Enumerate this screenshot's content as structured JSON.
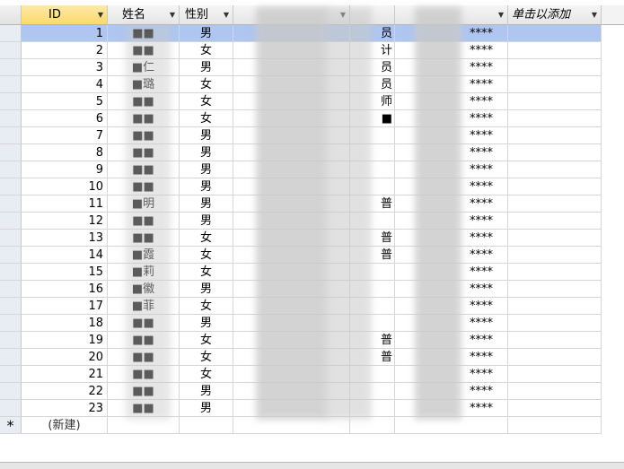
{
  "columns": {
    "id": "ID",
    "name": "姓名",
    "gender": "性别",
    "add_column": "单击以添加"
  },
  "rows": [
    {
      "id": "1",
      "name": "■■",
      "gender": "男",
      "title": "员",
      "phone_suffix": "****"
    },
    {
      "id": "2",
      "name": "■■",
      "gender": "女",
      "title": "计",
      "phone_suffix": "****"
    },
    {
      "id": "3",
      "name": "■仁",
      "gender": "男",
      "title": "员",
      "phone_suffix": "****"
    },
    {
      "id": "4",
      "name": "■璐",
      "gender": "女",
      "title": "员",
      "phone_suffix": "****"
    },
    {
      "id": "5",
      "name": "■■",
      "gender": "女",
      "title": "师",
      "phone_suffix": "****"
    },
    {
      "id": "6",
      "name": "■■",
      "gender": "女",
      "title": "■",
      "phone_suffix": "****"
    },
    {
      "id": "7",
      "name": "■■",
      "gender": "男",
      "title": "",
      "phone_suffix": "****"
    },
    {
      "id": "8",
      "name": "■■",
      "gender": "男",
      "title": "",
      "phone_suffix": "****"
    },
    {
      "id": "9",
      "name": "■■",
      "gender": "男",
      "title": "",
      "phone_suffix": "****"
    },
    {
      "id": "10",
      "name": "■■",
      "gender": "男",
      "title": "",
      "phone_suffix": "****"
    },
    {
      "id": "11",
      "name": "■明",
      "gender": "男",
      "title": "普",
      "phone_suffix": "****"
    },
    {
      "id": "12",
      "name": "■■",
      "gender": "男",
      "title": "",
      "phone_suffix": "****"
    },
    {
      "id": "13",
      "name": "■■",
      "gender": "女",
      "title": "普",
      "phone_suffix": "****"
    },
    {
      "id": "14",
      "name": "■霞",
      "gender": "女",
      "title": "普",
      "phone_suffix": "****"
    },
    {
      "id": "15",
      "name": "■莉",
      "gender": "女",
      "title": "",
      "phone_suffix": "****"
    },
    {
      "id": "16",
      "name": "■徽",
      "gender": "男",
      "title": "",
      "phone_suffix": "****"
    },
    {
      "id": "17",
      "name": "■菲",
      "gender": "女",
      "title": "",
      "phone_suffix": "****"
    },
    {
      "id": "18",
      "name": "■■",
      "gender": "男",
      "title": "",
      "phone_suffix": "****"
    },
    {
      "id": "19",
      "name": "■■",
      "gender": "女",
      "title": "普",
      "phone_suffix": "****"
    },
    {
      "id": "20",
      "name": "■■",
      "gender": "女",
      "title": "普",
      "phone_suffix": "****"
    },
    {
      "id": "21",
      "name": "■■",
      "gender": "女",
      "title": "",
      "phone_suffix": "****"
    },
    {
      "id": "22",
      "name": "■■",
      "gender": "男",
      "title": "",
      "phone_suffix": "****"
    },
    {
      "id": "23",
      "name": "■■",
      "gender": "男",
      "title": "",
      "phone_suffix": "****"
    }
  ],
  "new_row": {
    "marker": "*",
    "label": "(新建)"
  },
  "colors": {
    "current_row": "#aec6f0",
    "header_selected": "#fcd96c"
  }
}
